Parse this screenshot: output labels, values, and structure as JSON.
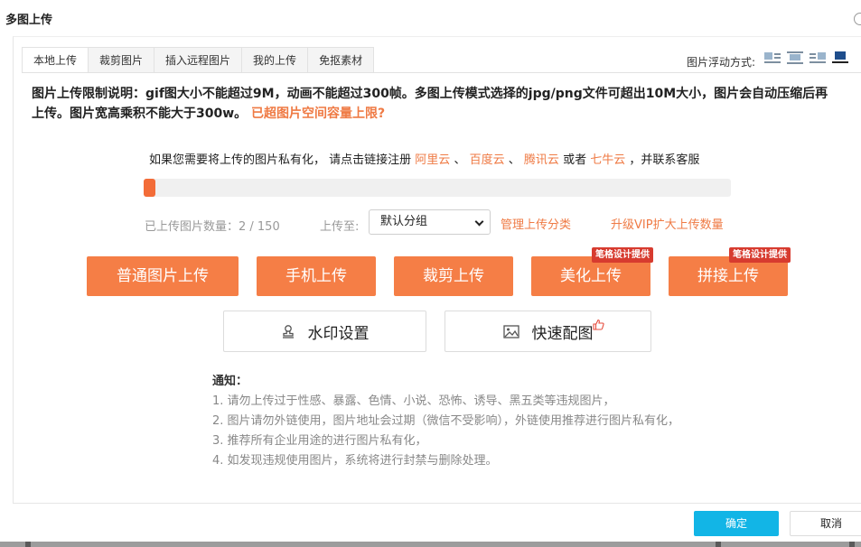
{
  "dialog": {
    "title": "多图上传"
  },
  "tabs": [
    {
      "label": "本地上传",
      "active": true
    },
    {
      "label": "裁剪图片",
      "active": false
    },
    {
      "label": "插入远程图片",
      "active": false
    },
    {
      "label": "我的上传",
      "active": false
    },
    {
      "label": "免抠素材",
      "active": false
    }
  ],
  "float_mode": {
    "label": "图片浮动方式:",
    "options": [
      "float-left-icon",
      "float-center-icon",
      "float-right-icon",
      "float-none-icon"
    ],
    "selected_index": 3
  },
  "limit": {
    "text": "图片上传限制说明：gif图大小不能超过9M，动画不能超过300帧。多图上传模式选择的jpg/png文件可超出10M大小，图片会自动压缩后再上传。图片宽高乘积不能大于300w。",
    "link": "已超图片空间容量上限?"
  },
  "private": {
    "prefix": "如果您需要将上传的图片私有化， 请点击链接注册",
    "aliyun": "阿里云",
    "sep1": "、",
    "baidu": "百度云",
    "sep2": "、",
    "tencent": "腾讯云",
    "or": "或者",
    "qiniu": "七牛云",
    "suffix": "，并联系客服"
  },
  "progress": {
    "fraction": 0.0133
  },
  "upload": {
    "count_label": "已上传图片数量：2 / 150",
    "upload_to_label": "上传至:",
    "group_value": "默认分组",
    "manage_link": "管理上传分类",
    "vip_link": "升级VIP扩大上传数量"
  },
  "buttons": {
    "normal": "普通图片上传",
    "mobile": "手机上传",
    "crop": "裁剪上传",
    "beautify": "美化上传",
    "splice": "拼接上传",
    "beautify_tag": "笔格设计提供",
    "splice_tag": "笔格设计提供",
    "watermark": "水印设置",
    "quick": "快速配图"
  },
  "notice": {
    "title": "通知：",
    "items": [
      "1. 请勿上传过于性感、暴露、色情、小说、恐怖、诱导、黑五类等违规图片，",
      "2. 图片请勿外链使用，图片地址会过期（微信不受影响），外链使用推荐进行图片私有化，",
      "3. 推荐所有企业用途的进行图片私有化，",
      "4. 如发现违规使用图片，系统将进行封禁与删除处理。"
    ]
  },
  "footer": {
    "confirm": "确定",
    "cancel": "取消"
  },
  "colors": {
    "accent": "#f57e46",
    "link": "#ef7a44",
    "tag": "#d73b2f",
    "confirm": "#12b5e6"
  }
}
